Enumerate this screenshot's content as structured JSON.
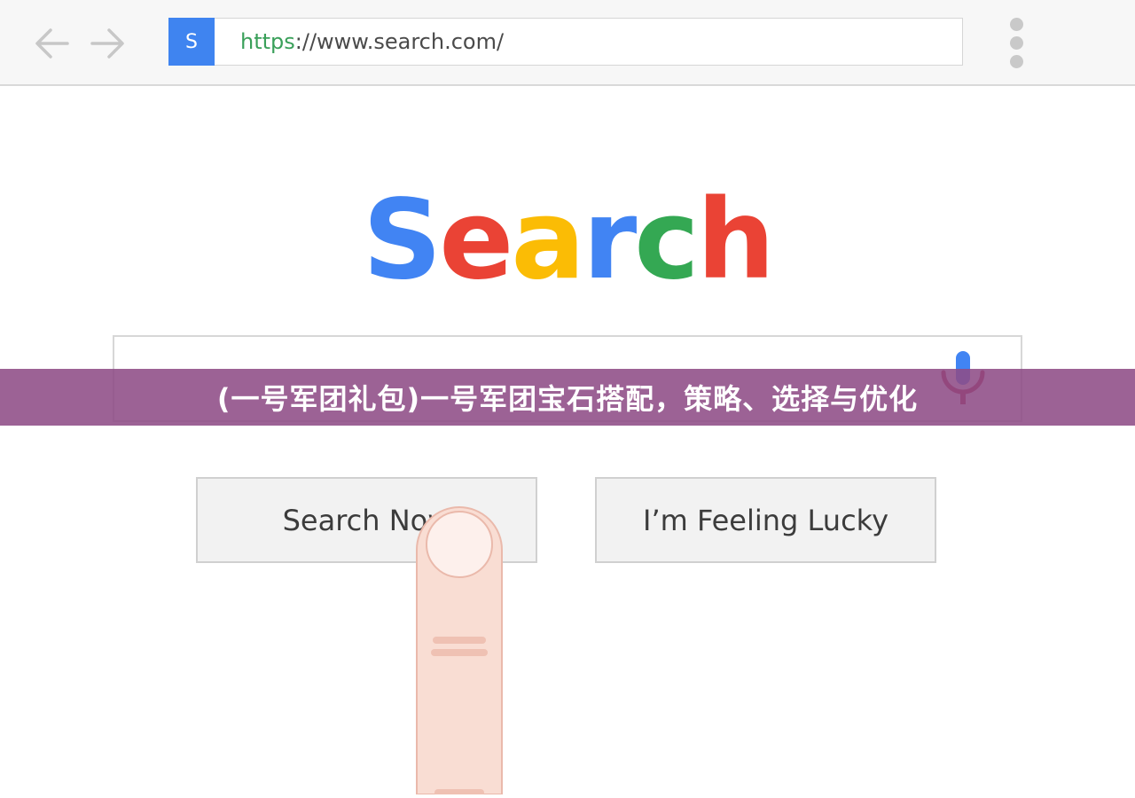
{
  "browser": {
    "favicon_letter": "S",
    "url_scheme": "https",
    "url_rest": "://www.search.com/",
    "back_icon": "arrow-left-icon",
    "forward_icon": "arrow-right-icon",
    "menu_icon": "kebab-menu-icon"
  },
  "logo": {
    "letters": [
      "S",
      "e",
      "a",
      "r",
      "c",
      "h"
    ],
    "colors": [
      "#4184f3",
      "#ea4335",
      "#fbbc05",
      "#4184f3",
      "#34a853",
      "#ea4335"
    ]
  },
  "search": {
    "value": "",
    "mic_icon": "microphone-icon"
  },
  "banner": {
    "text": "(一号军团礼包)一号军团宝石搭配，策略、选择与优化",
    "color": "#8e4c86"
  },
  "buttons": {
    "search_now": "Search Now",
    "feeling_lucky": "I’m Feeling Lucky"
  },
  "colors": {
    "favicon_bg": "#3f84f0",
    "url_scheme": "#3aa05a",
    "mic": "#4184f3",
    "mic_stand": "#b0263f"
  }
}
